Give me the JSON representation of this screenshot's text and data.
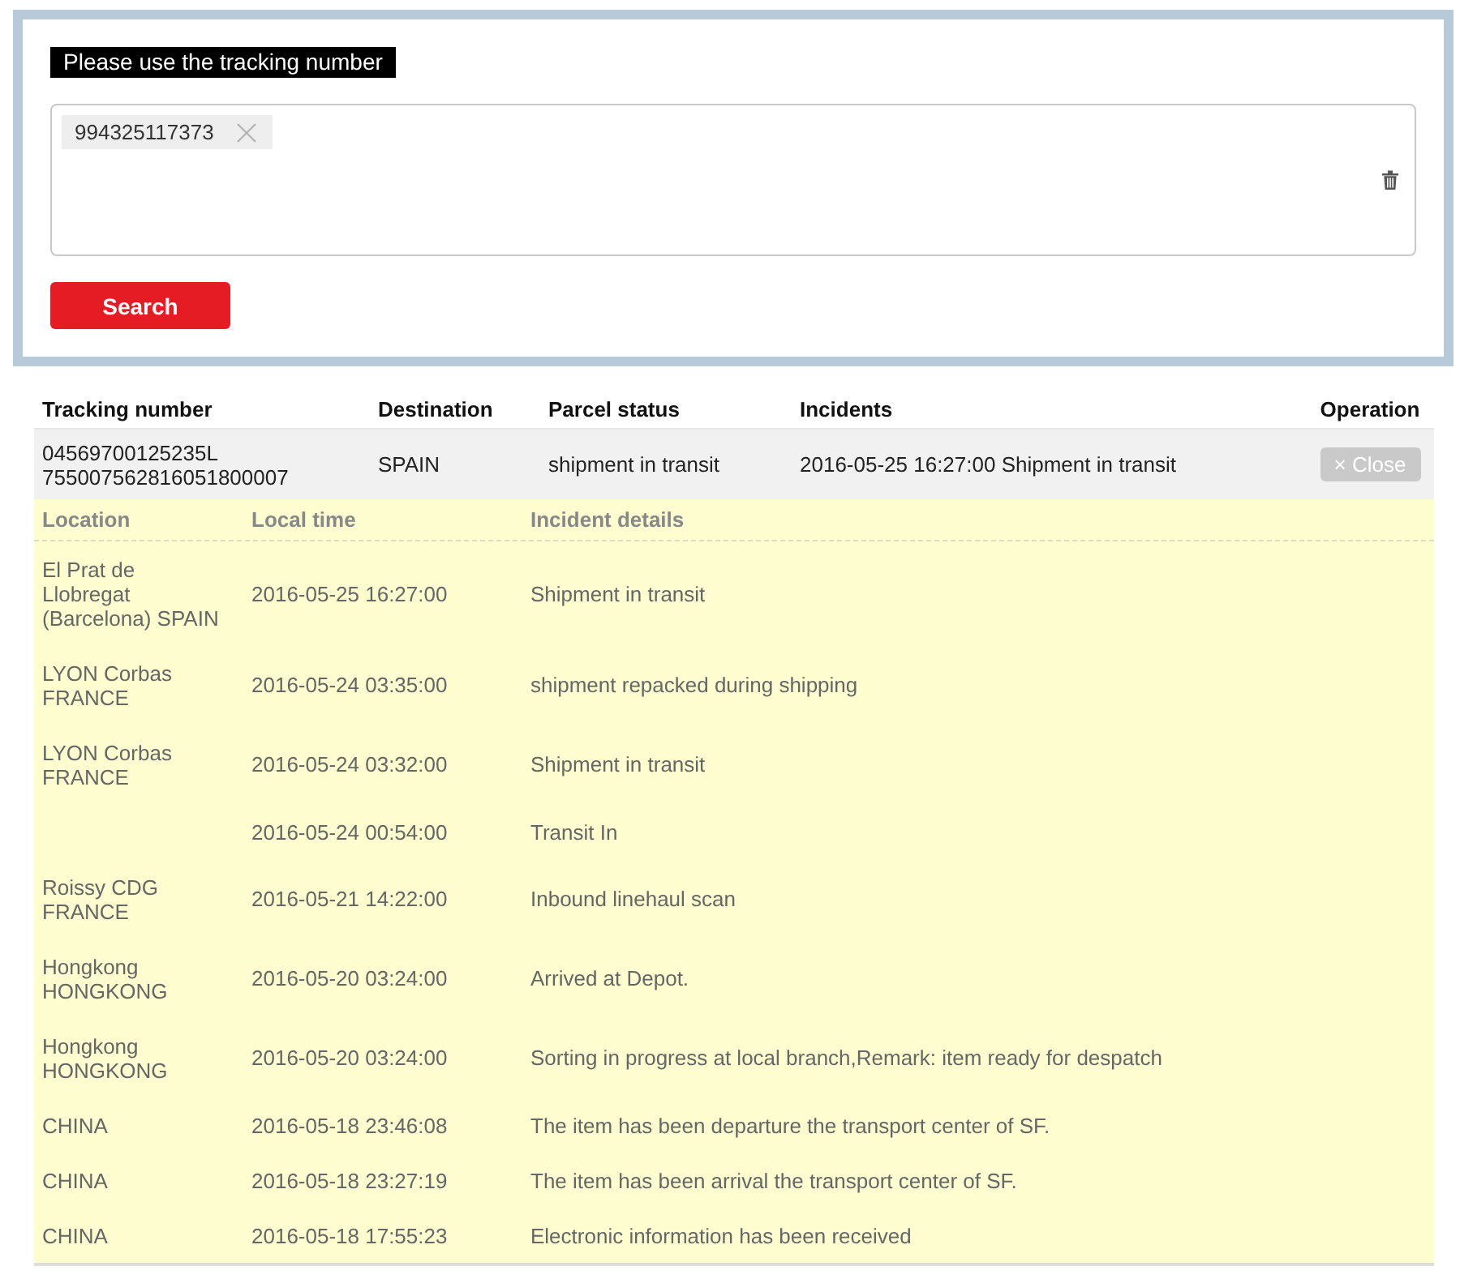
{
  "search_panel": {
    "label": "Please use the tracking number",
    "tags": [
      "994325117373"
    ],
    "button": "Search"
  },
  "results": {
    "columns": [
      "Tracking number",
      "Destination",
      "Parcel status",
      "Incidents",
      "Operation"
    ],
    "rows": [
      {
        "tracking_number": [
          "04569700125235L",
          "755007562816051800007"
        ],
        "destination": "SPAIN",
        "parcel_status": "shipment in transit",
        "incidents": "2016-05-25 16:27:00 Shipment in transit",
        "operation": "× Close",
        "expanded": true,
        "details": {
          "columns": [
            "Location",
            "Local time",
            "Incident details"
          ],
          "events": [
            {
              "location": [
                "El Prat de",
                "Llobregat",
                "(Barcelona) SPAIN"
              ],
              "local_time": "2016-05-25 16:27:00",
              "details": "Shipment in transit"
            },
            {
              "location": [
                "LYON Corbas",
                "FRANCE"
              ],
              "local_time": "2016-05-24 03:35:00",
              "details": "shipment repacked during shipping"
            },
            {
              "location": [
                "LYON Corbas",
                "FRANCE"
              ],
              "local_time": "2016-05-24 03:32:00",
              "details": "Shipment in transit"
            },
            {
              "local_time": "2016-05-24 00:54:00",
              "details": "Transit In"
            },
            {
              "location": [
                "Roissy CDG",
                "FRANCE"
              ],
              "local_time": "2016-05-21 14:22:00",
              "details": "Inbound linehaul scan"
            },
            {
              "location": [
                "Hongkong",
                "HONGKONG"
              ],
              "local_time": "2016-05-20 03:24:00",
              "details": "Arrived at Depot."
            },
            {
              "location": [
                "Hongkong",
                "HONGKONG"
              ],
              "local_time": "2016-05-20 03:24:00",
              "details": "Sorting in progress at local branch,Remark: item ready for despatch"
            },
            {
              "location": [
                "CHINA"
              ],
              "local_time": "2016-05-18 23:46:08",
              "details": "The item has been departure the transport center of SF."
            },
            {
              "location": [
                "CHINA"
              ],
              "local_time": "2016-05-18 23:27:19",
              "details": "The item has been arrival the transport center of SF."
            },
            {
              "location": [
                "CHINA"
              ],
              "local_time": "2016-05-18 17:55:23",
              "details": "Electronic information has been received"
            }
          ]
        }
      }
    ]
  }
}
